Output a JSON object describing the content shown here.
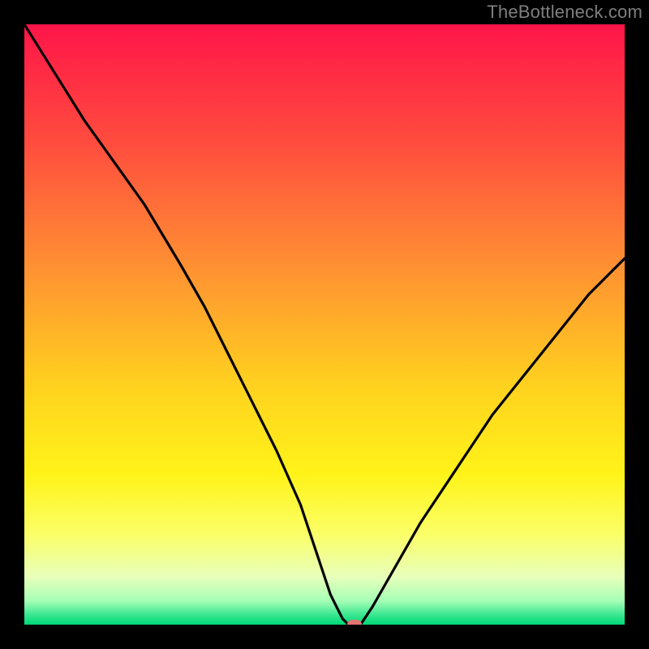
{
  "watermark": "TheBottleneck.com",
  "chart_data": {
    "type": "line",
    "title": "",
    "xlabel": "",
    "ylabel": "",
    "xlim": [
      0,
      100
    ],
    "ylim": [
      0,
      100
    ],
    "curve": {
      "name": "bottleneck-percentage",
      "x": [
        0,
        5,
        10,
        15,
        20,
        23,
        26,
        30,
        34,
        38,
        42,
        46,
        49,
        51,
        53,
        54,
        55,
        56,
        58,
        62,
        66,
        70,
        74,
        78,
        82,
        86,
        90,
        94,
        98,
        100
      ],
      "y": [
        100,
        92,
        84,
        77,
        70,
        65,
        60,
        53,
        45,
        37,
        29,
        20,
        11,
        5,
        1,
        0,
        0,
        0,
        3,
        10,
        17,
        23,
        29,
        35,
        40,
        45,
        50,
        55,
        59,
        61
      ]
    },
    "marker": {
      "x": 55,
      "y": 0
    },
    "gradient_stops": [
      {
        "offset": 0.0,
        "color": "#ff1549"
      },
      {
        "offset": 0.2,
        "color": "#ff4d3e"
      },
      {
        "offset": 0.4,
        "color": "#ff8f33"
      },
      {
        "offset": 0.6,
        "color": "#ffd11f"
      },
      {
        "offset": 0.75,
        "color": "#fff319"
      },
      {
        "offset": 0.85,
        "color": "#fbff68"
      },
      {
        "offset": 0.92,
        "color": "#e8ffba"
      },
      {
        "offset": 0.96,
        "color": "#a7ffb7"
      },
      {
        "offset": 0.985,
        "color": "#34e58e"
      },
      {
        "offset": 1.0,
        "color": "#00d878"
      }
    ],
    "curve_color": "#000000",
    "marker_color": "#e57373"
  }
}
